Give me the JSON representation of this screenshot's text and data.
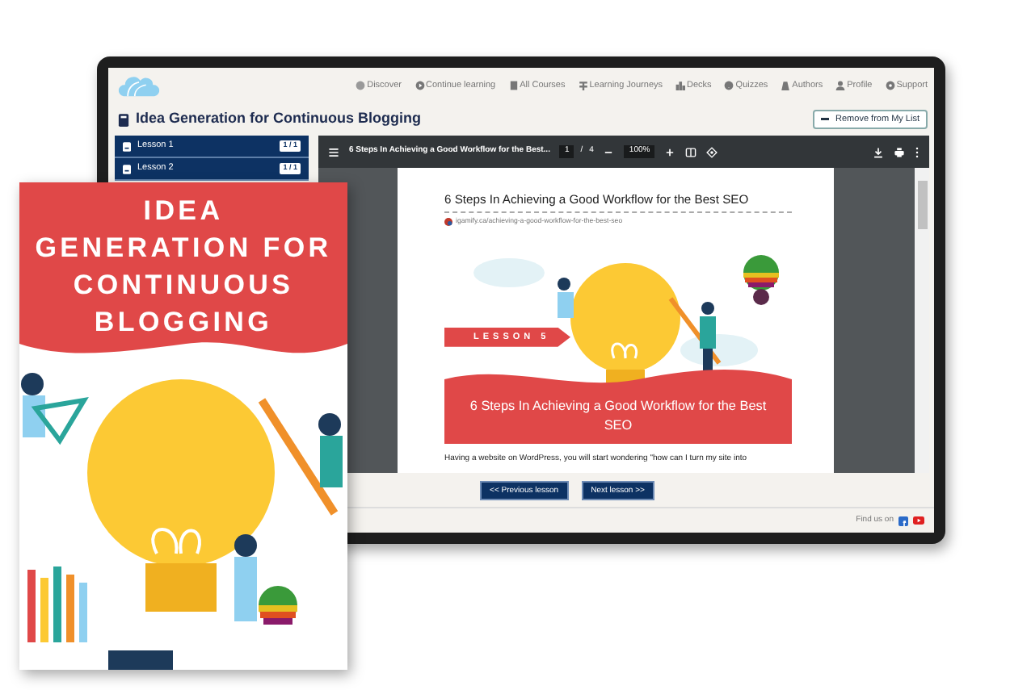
{
  "monitor": {
    "nav": [
      {
        "label": "Discover"
      },
      {
        "label": "Continue learning"
      },
      {
        "label": "All Courses"
      },
      {
        "label": "Learning Journeys"
      },
      {
        "label": "Decks"
      },
      {
        "label": "Quizzes"
      },
      {
        "label": "Authors"
      },
      {
        "label": "Profile"
      },
      {
        "label": "Support"
      }
    ],
    "course_title": "Idea Generation for Continuous Blogging",
    "remove_button": "Remove from My List",
    "lessons": [
      {
        "label": "Lesson 1",
        "badge": "1 / 1"
      },
      {
        "label": "Lesson 2",
        "badge": "1 / 1"
      }
    ],
    "pdf_viewer": {
      "title": "6 Steps In Achieving a Good Workflow for the Best...",
      "page": "1",
      "page_separator": "/",
      "page_count": "4",
      "zoom": "100%",
      "document": {
        "heading": "6 Steps In Achieving a Good Workflow for the Best SEO",
        "source": "igamify.ca/achieving-a-good-workflow-for-the-best-seo",
        "banner_tag": "LESSON 5",
        "banner_title": "6 Steps In Achieving a Good Workflow for the Best SEO",
        "paragraph": "Having a website on WordPress, you will start wondering \"how can I turn my site into"
      }
    },
    "buttons": [
      "<< Previous lesson",
      "Next lesson >>"
    ],
    "footer": "Find us on"
  },
  "book_cover": {
    "title_lines": [
      "IDEA",
      "GENERATION FOR",
      "CONTINUOUS",
      "BLOGGING"
    ]
  }
}
